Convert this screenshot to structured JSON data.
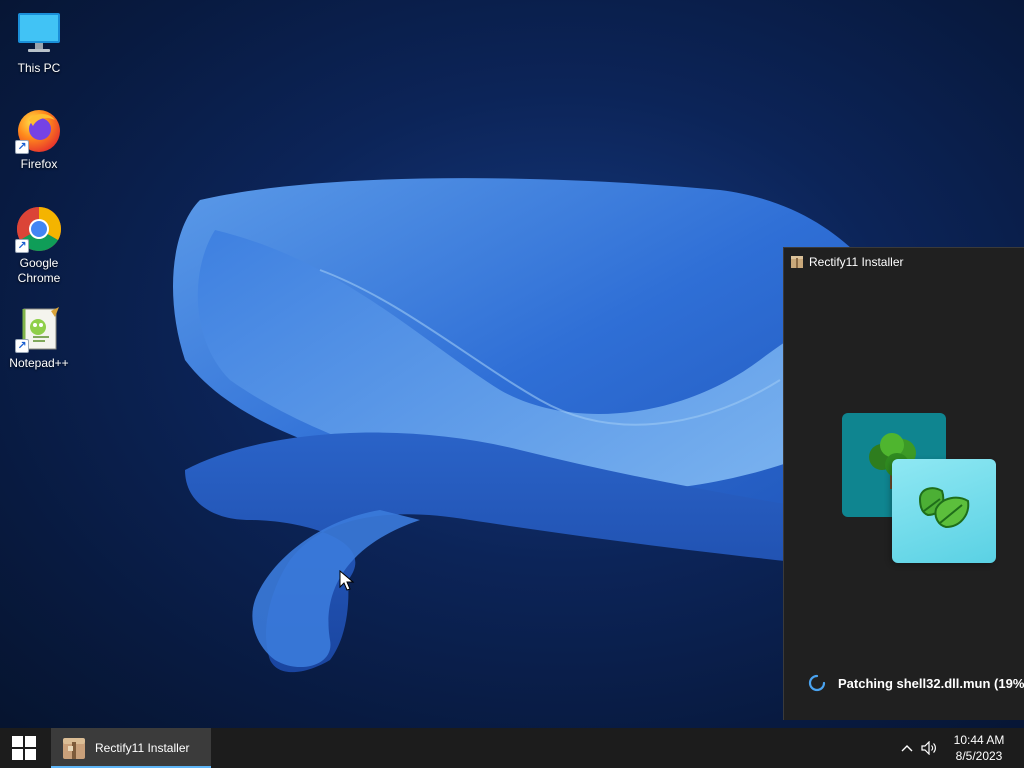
{
  "desktop": {
    "icons": [
      {
        "label": "This PC",
        "icon": "monitor-icon"
      },
      {
        "label": "Firefox",
        "icon": "firefox-icon"
      },
      {
        "label": "Google Chrome",
        "icon": "chrome-icon"
      },
      {
        "label": "Notepad++",
        "icon": "notepadpp-icon"
      }
    ]
  },
  "installer": {
    "title": "Rectify11 Installer",
    "status": "Patching shell32.dll.mun (19%",
    "accent_color": "#0f8590"
  },
  "taskbar": {
    "running_app_label": "Rectify11 Installer",
    "clock_time": "10:44 AM",
    "clock_date": "8/5/2023",
    "accent_color": "#5eb5f7"
  }
}
